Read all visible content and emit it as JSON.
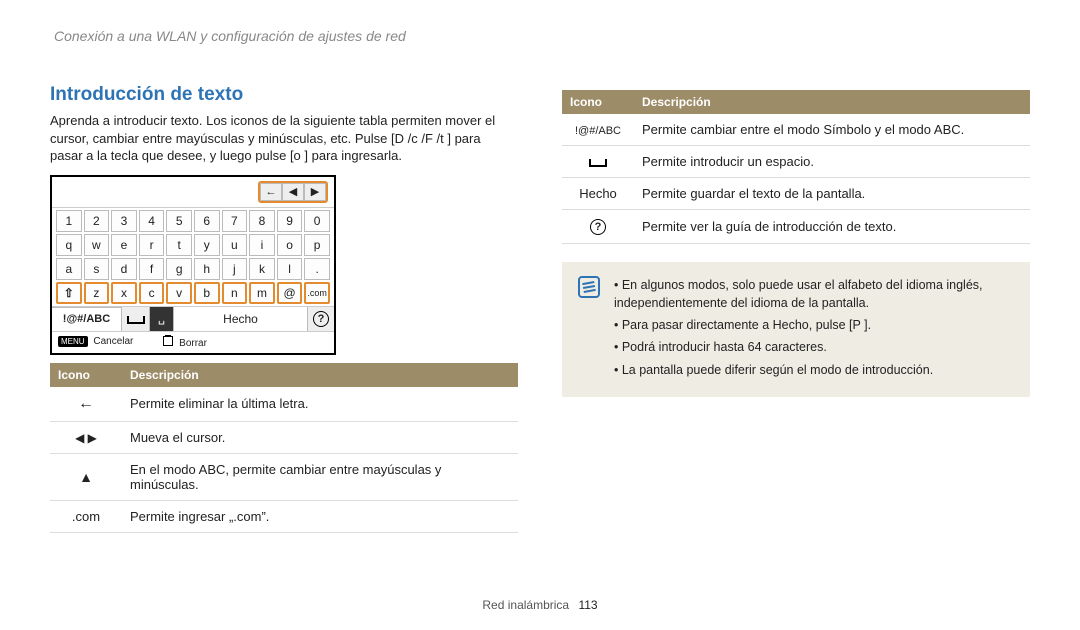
{
  "page_header": "Conexión a una WLAN y configuración de ajustes de red",
  "section_title": "Introducción de texto",
  "intro_lines": [
    "Aprenda a introducir texto. Los iconos de la siguiente tabla permiten mover el",
    "cursor, cambiar entre mayúsculas y minúsculas, etc. Pulse [D     /c  /F  /t     ] para",
    "pasar a la tecla que desee, y luego pulse [o     ] para ingresarla."
  ],
  "keyboard": {
    "rows": [
      [
        "1",
        "2",
        "3",
        "4",
        "5",
        "6",
        "7",
        "8",
        "9",
        "0"
      ],
      [
        "q",
        "w",
        "e",
        "r",
        "t",
        "y",
        "u",
        "i",
        "o",
        "p"
      ],
      [
        "a",
        "s",
        "d",
        "f",
        "g",
        "h",
        "j",
        "k",
        "l",
        "."
      ],
      [
        "⇧",
        "z",
        "x",
        "c",
        "v",
        "b",
        "n",
        "m",
        "@",
        ".com"
      ]
    ],
    "highlight_row": 3,
    "mode_label": "!@#/ABC",
    "hecho": "Hecho",
    "cancel_label": "Cancelar",
    "delete_label": "Borrar",
    "menu_badge": "MENU"
  },
  "table_left": {
    "headers": [
      "Icono",
      "Descripción"
    ],
    "rows": [
      {
        "icon": "back",
        "text": "Permite eliminar la última letra."
      },
      {
        "icon": "lr",
        "text": "Mueva el cursor."
      },
      {
        "icon": "up",
        "text": "En el modo ABC, permite cambiar entre mayúsculas y minúsculas."
      },
      {
        "icon": "dotcom",
        "label": ".com",
        "text": "Permite ingresar „.com”."
      }
    ]
  },
  "table_right": {
    "headers": [
      "Icono",
      "Descripción"
    ],
    "rows": [
      {
        "icon": "modeabc",
        "label": "!@#/ABC",
        "text": "Permite cambiar entre el modo Símbolo y el modo ABC."
      },
      {
        "icon": "space",
        "text": "Permite introducir un espacio."
      },
      {
        "icon": "hecho",
        "label": "Hecho",
        "text": "Permite guardar el texto de la pantalla."
      },
      {
        "icon": "help",
        "text": "Permite ver la guía de introducción de texto."
      }
    ]
  },
  "note": {
    "items": [
      "En algunos modos, solo puede usar el alfabeto del idioma inglés, independientemente del idioma de la pantalla.",
      "Para pasar directamente a Hecho, pulse [P     ].",
      "Podrá introducir hasta 64 caracteres.",
      "La pantalla puede diferir según el modo de introducción."
    ]
  },
  "footer": {
    "label": "Red inalámbrica",
    "page": "113"
  }
}
